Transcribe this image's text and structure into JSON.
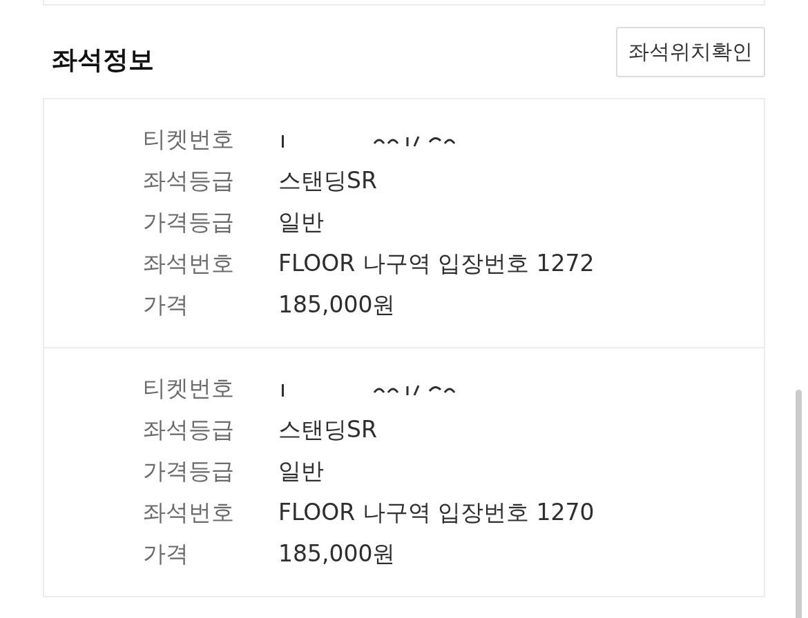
{
  "section": {
    "title": "좌석정보",
    "action_button": "좌석위치확인"
  },
  "tickets": [
    {
      "rows": [
        {
          "kind": "redacted",
          "label": "티켓번호"
        },
        {
          "kind": "text",
          "label": "좌석등급",
          "value": "스탠딩SR"
        },
        {
          "kind": "text",
          "label": "가격등급",
          "value": "일반"
        },
        {
          "kind": "text",
          "label": "좌석번호",
          "value": "FLOOR 나구역 입장번호 1272"
        },
        {
          "kind": "text",
          "label": "가격",
          "value": "185,000원"
        }
      ]
    },
    {
      "rows": [
        {
          "kind": "redacted",
          "label": "티켓번호"
        },
        {
          "kind": "text",
          "label": "좌석등급",
          "value": "스탠딩SR"
        },
        {
          "kind": "text",
          "label": "가격등급",
          "value": "일반"
        },
        {
          "kind": "text",
          "label": "좌석번호",
          "value": "FLOOR 나구역 입장번호 1270"
        },
        {
          "kind": "text",
          "label": "가격",
          "value": "185,000원"
        }
      ]
    }
  ]
}
